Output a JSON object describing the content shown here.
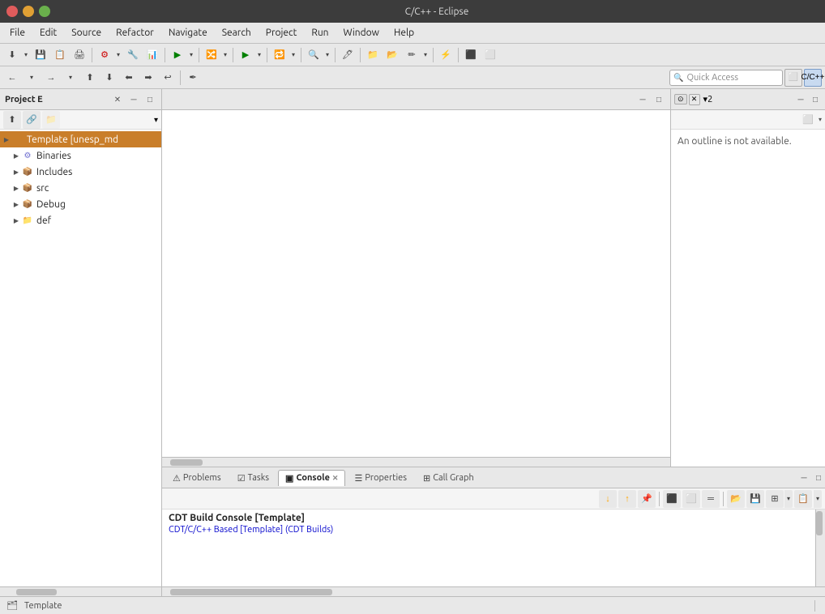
{
  "titlebar": {
    "title": "C/C++ - Eclipse"
  },
  "menubar": {
    "items": [
      "File",
      "Edit",
      "Source",
      "Refactor",
      "Navigate",
      "Search",
      "Project",
      "Run",
      "Window",
      "Help"
    ]
  },
  "toolbar1": {
    "buttons": [
      "⬇",
      "⬆",
      "📋",
      "🔄",
      "⚙",
      "🔧",
      "📊",
      "▶",
      "⏹",
      "🔀",
      "▶",
      "⏸",
      "🔁",
      "🔍",
      "🖊",
      "🖥",
      "📁",
      "📂",
      "✏",
      "⚡"
    ]
  },
  "toolbar2": {
    "back_label": "←",
    "forward_label": "→",
    "quick_access_placeholder": "Quick Access",
    "perspective1_label": "⬜",
    "perspective2_label": "C/C++"
  },
  "project_explorer": {
    "title": "Project E",
    "root": {
      "name": "Template [unesp_md",
      "children": [
        {
          "name": "Binaries",
          "type": "binaries"
        },
        {
          "name": "Includes",
          "type": "includes"
        },
        {
          "name": "src",
          "type": "src"
        },
        {
          "name": "Debug",
          "type": "debug"
        },
        {
          "name": "def",
          "type": "def"
        }
      ]
    }
  },
  "outline": {
    "title": "An outline is not available.",
    "panel_label": "▾2"
  },
  "bottom_tabs": {
    "items": [
      {
        "label": "Problems",
        "icon": "⚠",
        "active": false
      },
      {
        "label": "Tasks",
        "icon": "☑",
        "active": false
      },
      {
        "label": "Console",
        "icon": "▣",
        "active": true
      },
      {
        "label": "Properties",
        "icon": "☰",
        "active": false
      },
      {
        "label": "Call Graph",
        "icon": "⊞",
        "active": false
      }
    ]
  },
  "console": {
    "title": "CDT Build Console [Template]",
    "text": "CDT/C/C++ Based [Template] (CDT Builds)"
  },
  "statusbar": {
    "text": "Template"
  }
}
